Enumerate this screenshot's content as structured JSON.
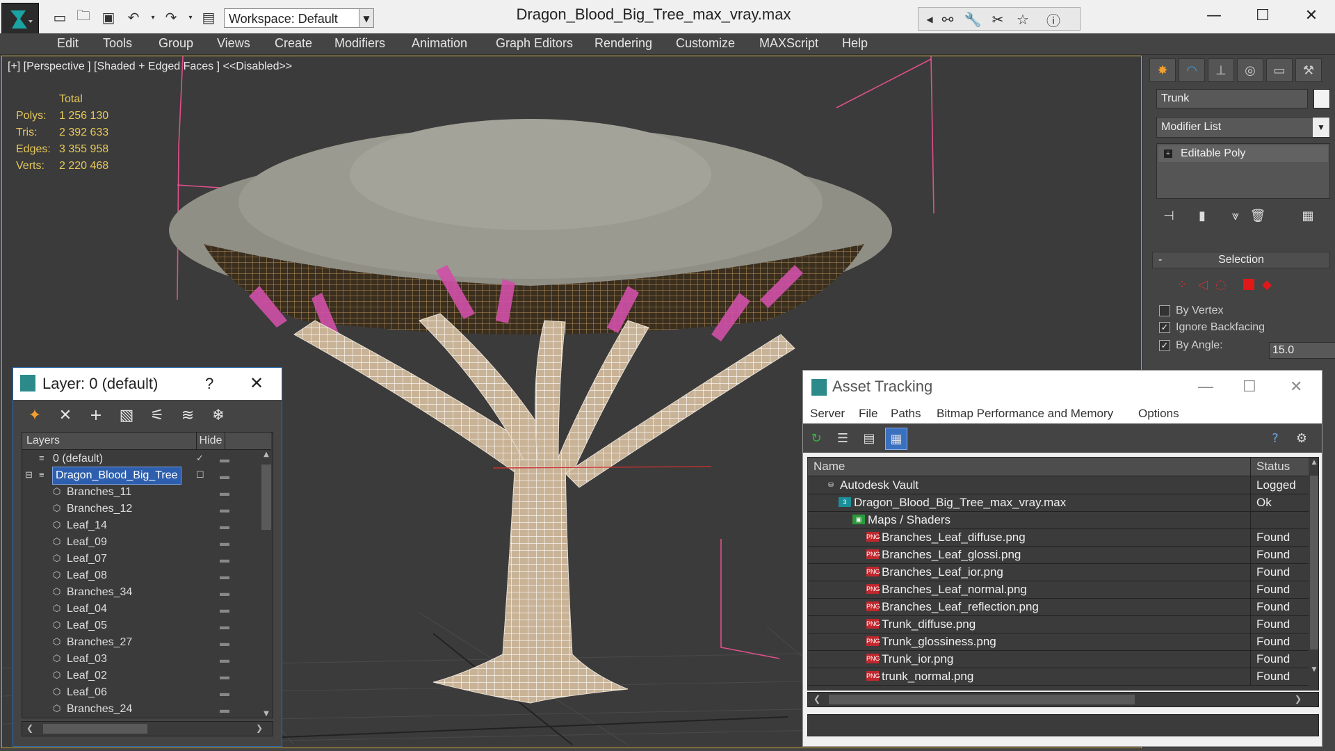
{
  "titlebar": {
    "workspace": "Workspace: Default",
    "window_title": "Dragon_Blood_Big_Tree_max_vray.max"
  },
  "menu": [
    "Edit",
    "Tools",
    "Group",
    "Views",
    "Create",
    "Modifiers",
    "Animation",
    "Graph Editors",
    "Rendering",
    "Customize",
    "MAXScript",
    "Help"
  ],
  "viewport": {
    "label": "[+] [Perspective ] [Shaded + Edged Faces ]  <<Disabled>>",
    "stats_header": "Total",
    "stats": [
      {
        "label": "Polys:",
        "value": "1 256 130"
      },
      {
        "label": "Tris:",
        "value": "2 392 633"
      },
      {
        "label": "Edges:",
        "value": "3 355 958"
      },
      {
        "label": "Verts:",
        "value": "2 220 468"
      }
    ]
  },
  "command_panel": {
    "object_name": "Trunk",
    "modifier_list": "Modifier List",
    "stack_item": "Editable Poly",
    "selection_title": "Selection",
    "by_vertex": "By Vertex",
    "ignore_backfacing": "Ignore Backfacing",
    "by_angle": "By Angle:",
    "angle_value": "15.0"
  },
  "layer_dialog": {
    "title": "Layer: 0 (default)",
    "help": "?",
    "col_layers": "Layers",
    "col_hide": "Hide",
    "rows": [
      {
        "name": "0 (default)",
        "level": 1,
        "icon": "layer-icon",
        "active": true
      },
      {
        "name": "Dragon_Blood_Big_Tree",
        "level": 1,
        "icon": "layer-icon",
        "selected": true
      },
      {
        "name": "Branches_11",
        "level": 2,
        "icon": "object-icon"
      },
      {
        "name": "Branches_12",
        "level": 2,
        "icon": "object-icon"
      },
      {
        "name": "Leaf_14",
        "level": 2,
        "icon": "object-icon"
      },
      {
        "name": "Leaf_09",
        "level": 2,
        "icon": "object-icon"
      },
      {
        "name": "Leaf_07",
        "level": 2,
        "icon": "object-icon"
      },
      {
        "name": "Leaf_08",
        "level": 2,
        "icon": "object-icon"
      },
      {
        "name": "Branches_34",
        "level": 2,
        "icon": "object-icon"
      },
      {
        "name": "Leaf_04",
        "level": 2,
        "icon": "object-icon"
      },
      {
        "name": "Leaf_05",
        "level": 2,
        "icon": "object-icon"
      },
      {
        "name": "Branches_27",
        "level": 2,
        "icon": "object-icon"
      },
      {
        "name": "Leaf_03",
        "level": 2,
        "icon": "object-icon"
      },
      {
        "name": "Leaf_02",
        "level": 2,
        "icon": "object-icon"
      },
      {
        "name": "Leaf_06",
        "level": 2,
        "icon": "object-icon"
      },
      {
        "name": "Branches_24",
        "level": 2,
        "icon": "object-icon"
      }
    ]
  },
  "asset_dialog": {
    "title": "Asset Tracking",
    "menu": [
      "Server",
      "File",
      "Paths",
      "Bitmap Performance and Memory",
      "Options"
    ],
    "col_name": "Name",
    "col_status": "Status",
    "rows": [
      {
        "name": "Autodesk Vault",
        "status": "Logged",
        "level": 1,
        "icon": "vault-icon"
      },
      {
        "name": "Dragon_Blood_Big_Tree_max_vray.max",
        "status": "Ok",
        "level": 2,
        "icon": "max-file-icon"
      },
      {
        "name": "Maps / Shaders",
        "status": "",
        "level": 3,
        "icon": "maps-icon"
      },
      {
        "name": "Branches_Leaf_diffuse.png",
        "status": "Found",
        "level": 4,
        "icon": "png-icon"
      },
      {
        "name": "Branches_Leaf_glossi.png",
        "status": "Found",
        "level": 4,
        "icon": "png-icon"
      },
      {
        "name": "Branches_Leaf_ior.png",
        "status": "Found",
        "level": 4,
        "icon": "png-icon"
      },
      {
        "name": "Branches_Leaf_normal.png",
        "status": "Found",
        "level": 4,
        "icon": "png-icon"
      },
      {
        "name": "Branches_Leaf_reflection.png",
        "status": "Found",
        "level": 4,
        "icon": "png-icon"
      },
      {
        "name": "Trunk_diffuse.png",
        "status": "Found",
        "level": 4,
        "icon": "png-icon"
      },
      {
        "name": "Trunk_glossiness.png",
        "status": "Found",
        "level": 4,
        "icon": "png-icon"
      },
      {
        "name": "Trunk_ior.png",
        "status": "Found",
        "level": 4,
        "icon": "png-icon"
      },
      {
        "name": "trunk_normal.png",
        "status": "Found",
        "level": 4,
        "icon": "png-icon"
      }
    ]
  },
  "colors": {
    "stats_text": "#e6c85a",
    "selection_blue": "#2e5fae",
    "viewport_border": "#c8a23a",
    "wire_pink": "#e0508c"
  }
}
